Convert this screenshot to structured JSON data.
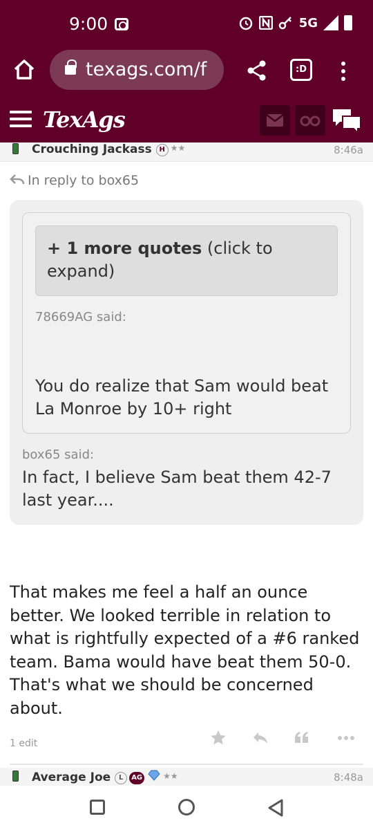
{
  "status_bar": {
    "time": "9:00",
    "network": "5G",
    "icons": [
      "screen-record-icon",
      "alarm-icon",
      "nfc-icon",
      "vpn-key-icon",
      "data-arrows-icon",
      "signal-icon",
      "battery-icon"
    ]
  },
  "browser": {
    "url": "texags.com/f",
    "tabs_label": ":D",
    "icons": [
      "home-icon",
      "lock-icon",
      "share-icon",
      "tabs-icon",
      "more-vert-icon"
    ]
  },
  "site": {
    "logo": "TexAgs",
    "icons": [
      "menu-icon",
      "mail-icon",
      "binoculars-icon",
      "chat-icon"
    ]
  },
  "post": {
    "author": "Crouching Jackass",
    "author_badge": "H",
    "time": "8:46a",
    "reply_to": "In reply to box65",
    "expand_bold": "+ 1 more quotes",
    "expand_rest": " (click to expand)",
    "quote1_author": "78669AG said:",
    "quote1_text": "You do realize that Sam would beat La Monroe by 10+ right",
    "quote2_author": "box65 said:",
    "quote2_text": "In fact, I believe Sam beat them 42-7 last year....",
    "body": "That makes me feel a half an ounce better. We looked terrible in relation to what is rightfully expected of a #6 ranked team. Bama would have beat them 50-0. That's what we should be concerned about.",
    "edits": "1 edit",
    "actions": [
      "star-icon",
      "reply-icon",
      "quote-icon",
      "more-horiz-icon"
    ]
  },
  "next_post": {
    "author": "Average Joe",
    "badge_l": "L",
    "badge_ag": "AG",
    "time": "8:48a"
  },
  "colors": {
    "brand": "#600028",
    "bubble": "#efefef"
  }
}
